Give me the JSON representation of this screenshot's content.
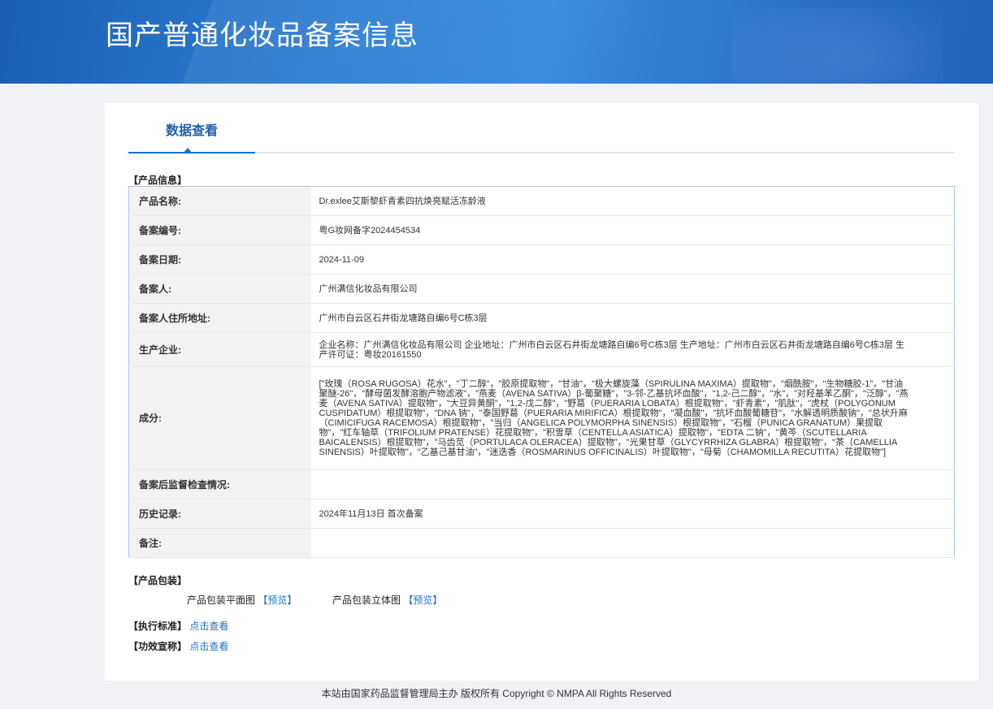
{
  "banner": {
    "title": "国产普通化妆品备案信息"
  },
  "tabs": [
    {
      "label": "数据查看"
    }
  ],
  "product_info": {
    "section_label": "【产品信息】",
    "rows": [
      {
        "key": "产品名称:",
        "value": "Dr.exlee艾斯黎虾青素四抗焕亮赋活冻龄液"
      },
      {
        "key": "备案编号:",
        "value": "粤G妆网备字2024454534"
      },
      {
        "key": "备案日期:",
        "value": "2024-11-09"
      },
      {
        "key": "备案人:",
        "value": "广州满信化妆品有限公司"
      },
      {
        "key": "备案人住所地址:",
        "value": "广州市白云区石井街龙塘路自编6号C栋3层"
      },
      {
        "key": "生产企业:",
        "value": "企业名称：广州满信化妆品有限公司 企业地址：广州市白云区石井街龙塘路自编6号C栋3层 生产地址：广州市白云区石井街龙塘路自编6号C栋3层 生产许可证：粤妆20161550"
      },
      {
        "key": "成分:",
        "value": "[\"玫瑰（ROSA RUGOSA）花水\"，\"丁二醇\"，\"胶原提取物\"，\"甘油\"，\"极大螺旋藻（SPIRULINA MAXIMA）提取物\"，\"烟酰胺\"，\"生物糖胶-1\"，\"甘油聚醚-26\"，\"酵母菌发酵溶胞产物滤液\"，\"燕麦（AVENA SATIVA）β-葡聚糖\"，\"3-邻-乙基抗坏血酸\"，\"1,2-己二醇\"，\"水\"，\"对羟基苯乙酮\"，\"泛醇\"，\"燕麦（AVENA SATIVA）提取物\"，\"大豆异黄酮\"，\"1,2-戊二醇\"，\"野葛（PUERARIA LOBATA）根提取物\"，\"虾青素\"，\"肌肽\"，\"虎杖（POLYGONUM CUSPIDATUM）根提取物\"，\"DNA 钠\"，\"泰国野葛（PUERARIA MIRIFICA）根提取物\"，\"凝血酸\"，\"抗坏血酸葡糖苷\"，\"水解透明质酸钠\"，\"总状升麻（CIMICIFUGA RACEMOSA）根提取物\"，\"当归（ANGELICA POLYMORPHA SINENSIS）根提取物\"，\"石榴（PUNICA GRANATUM）果提取物\"，\"红车轴草（TRIFOLIUM PRATENSE）花提取物\"，\"积雪草（CENTELLA ASIATICA）提取物\"，\"EDTA 二钠\"，\"黄芩（SCUTELLARIA BAICALENSIS）根提取物\"，\"马齿苋（PORTULACA OLERACEA）提取物\"，\"光果甘草（GLYCYRRHIZA GLABRA）根提取物\"，\"茶（CAMELLIA SINENSIS）叶提取物\"，\"乙基己基甘油\"，\"迷迭香（ROSMARINUS OFFICINALIS）叶提取物\"，\"母菊（CHAMOMILLA RECUTITA）花提取物\"]"
      },
      {
        "key": "备案后监督检查情况:",
        "value": ""
      },
      {
        "key": "历史记录:",
        "value": "2024年11月13日 首次备案"
      },
      {
        "key": "备注:",
        "value": ""
      }
    ]
  },
  "packaging": {
    "section_label": "【产品包装】",
    "flat_label": "产品包装平面图",
    "flat_link": "【预览】",
    "solid_label": "产品包装立体图",
    "solid_link": "【预览】"
  },
  "standard": {
    "label": "【执行标准】",
    "link": "点击查看"
  },
  "efficacy": {
    "label": "【功效宣称】",
    "link": "点击查看"
  },
  "footer": {
    "text": "本站由国家药品监督管理局主办 版权所有 Copyright © NMPA All Rights Reserved"
  },
  "colors": {
    "banner": "#2f7fd4",
    "accent": "#1d6fc9",
    "tab_text": "#1d5fa9",
    "table_border": "#a9c4e2",
    "key_bg": "#f2f2f2"
  }
}
